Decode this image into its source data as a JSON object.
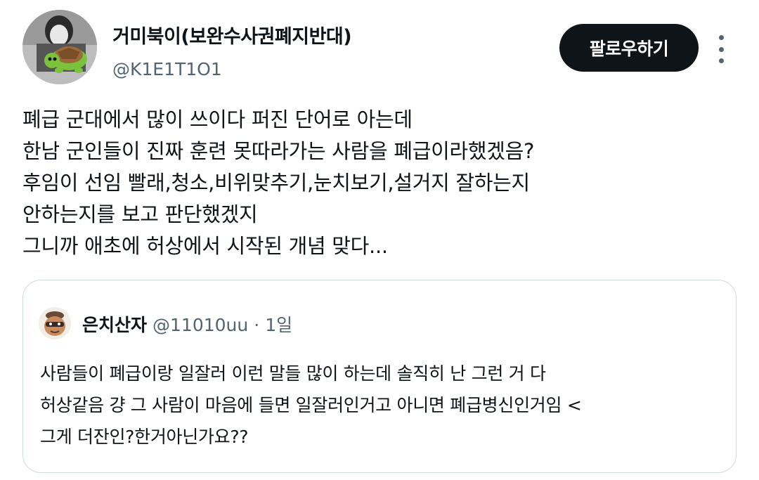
{
  "author": {
    "display_name": "거미북이(보완수사권폐지반대)",
    "handle": "@K1E1T1O1",
    "follow_label": "팔로우하기"
  },
  "tweet": {
    "lines": [
      "폐급 군대에서 많이 쓰이다 퍼진 단어로 아는데",
      "한남 군인들이 진짜 훈련 못따라가는 사람을 폐급이라했겠음?",
      "후임이 선임 빨래,청소,비위맞추기,눈치보기,설거지 잘하는지",
      "안하는지를 보고 판단했겠지",
      "그니까 애초에 허상에서 시작된 개념 맞다..."
    ]
  },
  "quote": {
    "display_name": "은치산자",
    "handle": "@11010uu",
    "separator": "·",
    "time": "1일",
    "lines": [
      "사람들이 폐급이랑 일잘러 이런 말들 많이 하는데 솔직히 난 그런 거 다",
      "허상같음 걍 그 사람이 마음에 들면 일잘러인거고 아니면 폐급병신인거임 <",
      "그게 더잔인?한거아닌가요??"
    ]
  },
  "icons": {
    "avatar": "profile-photo-with-turtle",
    "quote_avatar": "cartoon-face-avatar",
    "more": "more-options-icon"
  },
  "colors": {
    "text": "#0f1419",
    "secondary": "#536471",
    "button_bg": "#0f1419",
    "border": "#cfd9de"
  }
}
